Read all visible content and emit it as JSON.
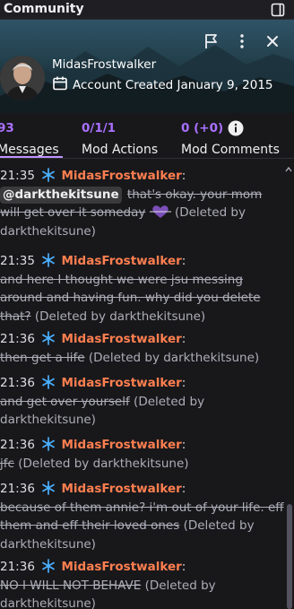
{
  "header": {
    "title": "Community",
    "dock_icon": "dock-panel-icon"
  },
  "banner": {
    "icons": [
      "flag-icon",
      "more-vertical-icon",
      "close-icon"
    ],
    "username": "MidasFrostwalker",
    "account_created_icon": "calendar-icon",
    "account_created": "Account Created January 9, 2015"
  },
  "tabs": [
    {
      "count": "93",
      "label": "Messages",
      "active": true
    },
    {
      "count": "0/1/1",
      "label": "Mod Actions"
    },
    {
      "count": "0 (+0)",
      "label": "Mod Comments",
      "icon": "info-icon"
    }
  ],
  "chat": {
    "badge_icon": "snowflake-icon",
    "name_color": "#ff7f50",
    "messages": [
      {
        "time": "21:35",
        "user": "MidasFrostwalker",
        "mention": "@darkthekitsune",
        "text": "that's okay. your mom will get over it someday",
        "emote": "purple-heart-emote",
        "deleted": "(Deleted by darkthekitsune)"
      },
      {
        "time": "21:35",
        "user": "MidasFrostwalker",
        "text": "and here I thought we were jsu messing around and having fun. why did you delete that?",
        "deleted": "(Deleted by darkthekitsune)"
      },
      {
        "time": "21:36",
        "user": "MidasFrostwalker",
        "text": "then get a life",
        "deleted": "(Deleted by darkthekitsune)"
      },
      {
        "time": "21:36",
        "user": "MidasFrostwalker",
        "text": "and get over yourself",
        "deleted": "(Deleted by darkthekitsune)"
      },
      {
        "time": "21:36",
        "user": "MidasFrostwalker",
        "text": "jfc",
        "deleted": "(Deleted by darkthekitsune)"
      },
      {
        "time": "21:36",
        "user": "MidasFrostwalker",
        "text": "because of them annie? i'm out of your life. eff them and eff their loved ones",
        "deleted": "(Deleted by darkthekitsune)"
      },
      {
        "time": "21:36",
        "user": "MidasFrostwalker",
        "text": "NO I WILL NOT BEHAVE",
        "deleted": "(Deleted by darkthekitsune)"
      }
    ]
  },
  "colors": {
    "accent": "#a970ff",
    "tab_underline": "#bf94ff",
    "background": "#18181b"
  }
}
